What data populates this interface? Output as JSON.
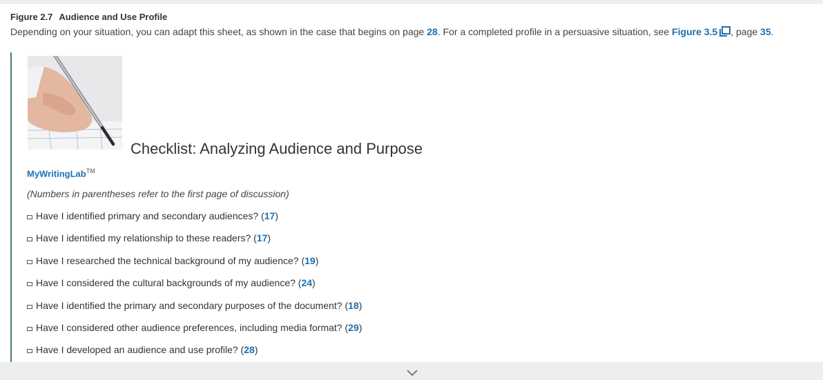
{
  "figure": {
    "number": "Figure 2.7",
    "title": "Audience and Use Profile",
    "desc_prefix": "Depending on your situation, you can adapt this sheet, as shown in the case that begins on page",
    "page_link_1": "28",
    "desc_middle": ". For a completed profile in a persuasive situation, see",
    "figure_link": "Figure 3.5",
    "desc_page_prefix": ", page",
    "page_link_2": "35",
    "desc_end": "."
  },
  "checklist": {
    "title": "Checklist: Analyzing Audience and Purpose",
    "lab_link": "MyWritingLab",
    "lab_tm": "TM",
    "note": "(Numbers in parentheses refer to the first page of discussion)",
    "items": [
      {
        "text": "Have I identified primary and secondary audiences?",
        "page": "17"
      },
      {
        "text": "Have I identified my relationship to these readers?",
        "page": "17"
      },
      {
        "text": "Have I researched the technical background of my audience?",
        "page": "19"
      },
      {
        "text": "Have I considered the cultural backgrounds of my audience?",
        "page": "24"
      },
      {
        "text": "Have I identified the primary and secondary purposes of the document?",
        "page": "18"
      },
      {
        "text": "Have I considered other audience preferences, including media format?",
        "page": "29"
      },
      {
        "text": "Have I developed an audience and use profile?",
        "page": "28"
      }
    ]
  },
  "icons": {
    "popup": "external-window-icon",
    "next": "chevron-down-icon",
    "photo": "hand-writing-photo"
  },
  "colors": {
    "link": "#1c6fb0",
    "rule": "#4a7d6c"
  }
}
